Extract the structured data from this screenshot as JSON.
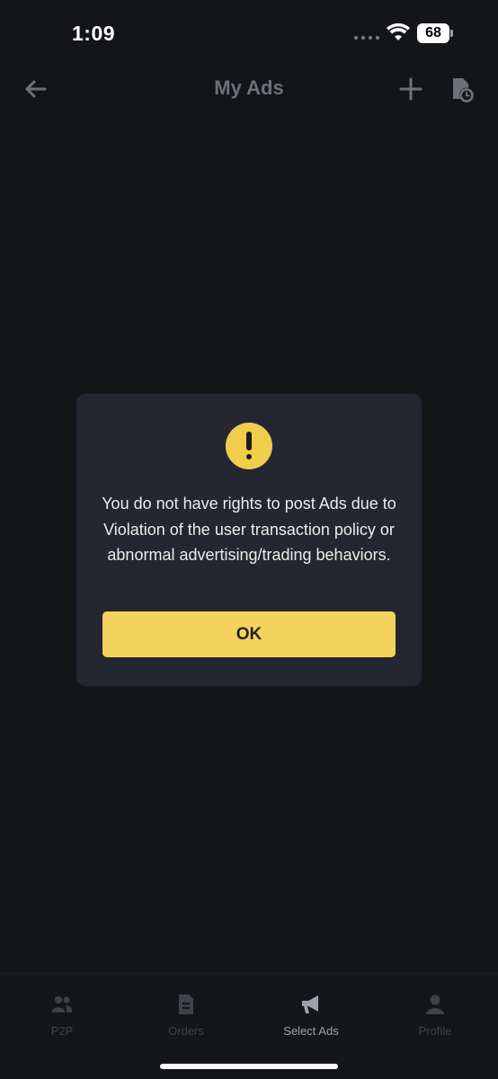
{
  "status_bar": {
    "time": "1:09",
    "battery_level": "68"
  },
  "nav": {
    "title": "My Ads",
    "back_icon": "arrow-left-icon",
    "add_icon": "plus-icon",
    "history_icon": "document-clock-icon"
  },
  "dialog": {
    "icon": "warning-icon",
    "message": "You do not have rights to post Ads due to Violation of the user transaction policy or abnormal advertising/trading behaviors.",
    "ok_label": "OK"
  },
  "bottom_nav": {
    "tabs": [
      {
        "label": "P2P",
        "icon": "users-icon",
        "active": false
      },
      {
        "label": "Orders",
        "icon": "document-icon",
        "active": false
      },
      {
        "label": "Select Ads",
        "icon": "megaphone-icon",
        "active": true
      },
      {
        "label": "Profile",
        "icon": "person-icon",
        "active": false
      }
    ]
  },
  "colors": {
    "background": "#131519",
    "dialog_bg": "#242731",
    "accent_yellow": "#f3d35c",
    "text_dim": "#6e7178"
  }
}
